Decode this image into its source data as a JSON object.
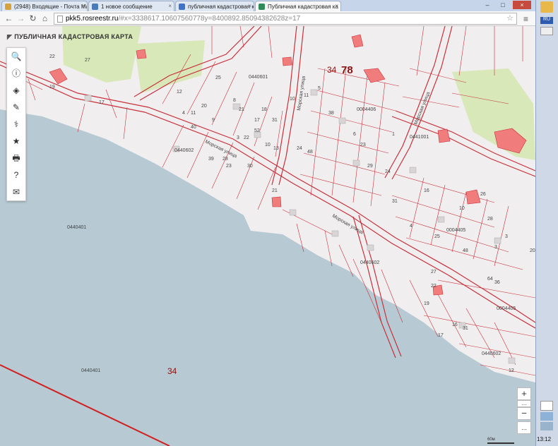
{
  "tabs": [
    {
      "label": "(2948) Входящие - Почта Ma",
      "icon": "mail-favicon",
      "color": "#d7a23b"
    },
    {
      "label": "1 новое сообщение",
      "icon": "page-favicon",
      "color": "#4a7ab7"
    },
    {
      "label": "публичная кадастровая ка",
      "icon": "search-favicon",
      "color": "#3f72c9"
    },
    {
      "label": "Публичная кадастровая ка",
      "icon": "map-favicon",
      "color": "#2e8b57"
    }
  ],
  "window_controls": [
    "–",
    "□",
    "×"
  ],
  "address": {
    "host": "pkk5.rosreestr.ru",
    "rest": "/#x=3338617.10607560778y=8400892.85094382628z=17"
  },
  "app_title": "ПУБЛИЧНАЯ КАДАСТРОВАЯ КАРТА",
  "tools": [
    "search-icon",
    "info-icon",
    "layers-icon",
    "draw-icon",
    "measure-icon",
    "bookmark-icon",
    "print-icon",
    "help-icon",
    "mail-icon"
  ],
  "tool_glyphs": [
    "🔍",
    "ⓘ",
    "◈",
    "✎",
    "⚕",
    "★",
    "🖶",
    "?",
    "✉"
  ],
  "zoom": {
    "plus": "+",
    "minus": "−",
    "more": "..."
  },
  "scale_label": "60м",
  "map_labels": {
    "quarters": [
      "0440401",
      "0440602",
      "0440601",
      "0004406",
      "0441001",
      "0004405",
      "0440401",
      "0440602",
      "0004405",
      "0440602"
    ],
    "big_34a": "34",
    "big_78": "78",
    "big_34b": "34",
    "streets": [
      "Морская улица",
      "Морская улица",
      "Морская улица",
      "Морская улица"
    ],
    "parcels": [
      "27",
      "22",
      "19",
      "17",
      "25",
      "12",
      "11",
      "9",
      "20",
      "8",
      "21",
      "22",
      "10",
      "31",
      "17",
      "18",
      "13",
      "3",
      "52",
      "4",
      "40",
      "39",
      "28",
      "23",
      "30",
      "21",
      "24",
      "48",
      "38",
      "5",
      "11",
      "10",
      "6",
      "23",
      "29",
      "24",
      "1",
      "31",
      "4",
      "16",
      "10",
      "26",
      "28",
      "3",
      "25",
      "48",
      "27",
      "22",
      "19",
      "17",
      "16",
      "12",
      "31",
      "64",
      "20",
      "36",
      "3"
    ]
  },
  "taskbar": {
    "lang": "RU",
    "time": "13:12"
  }
}
